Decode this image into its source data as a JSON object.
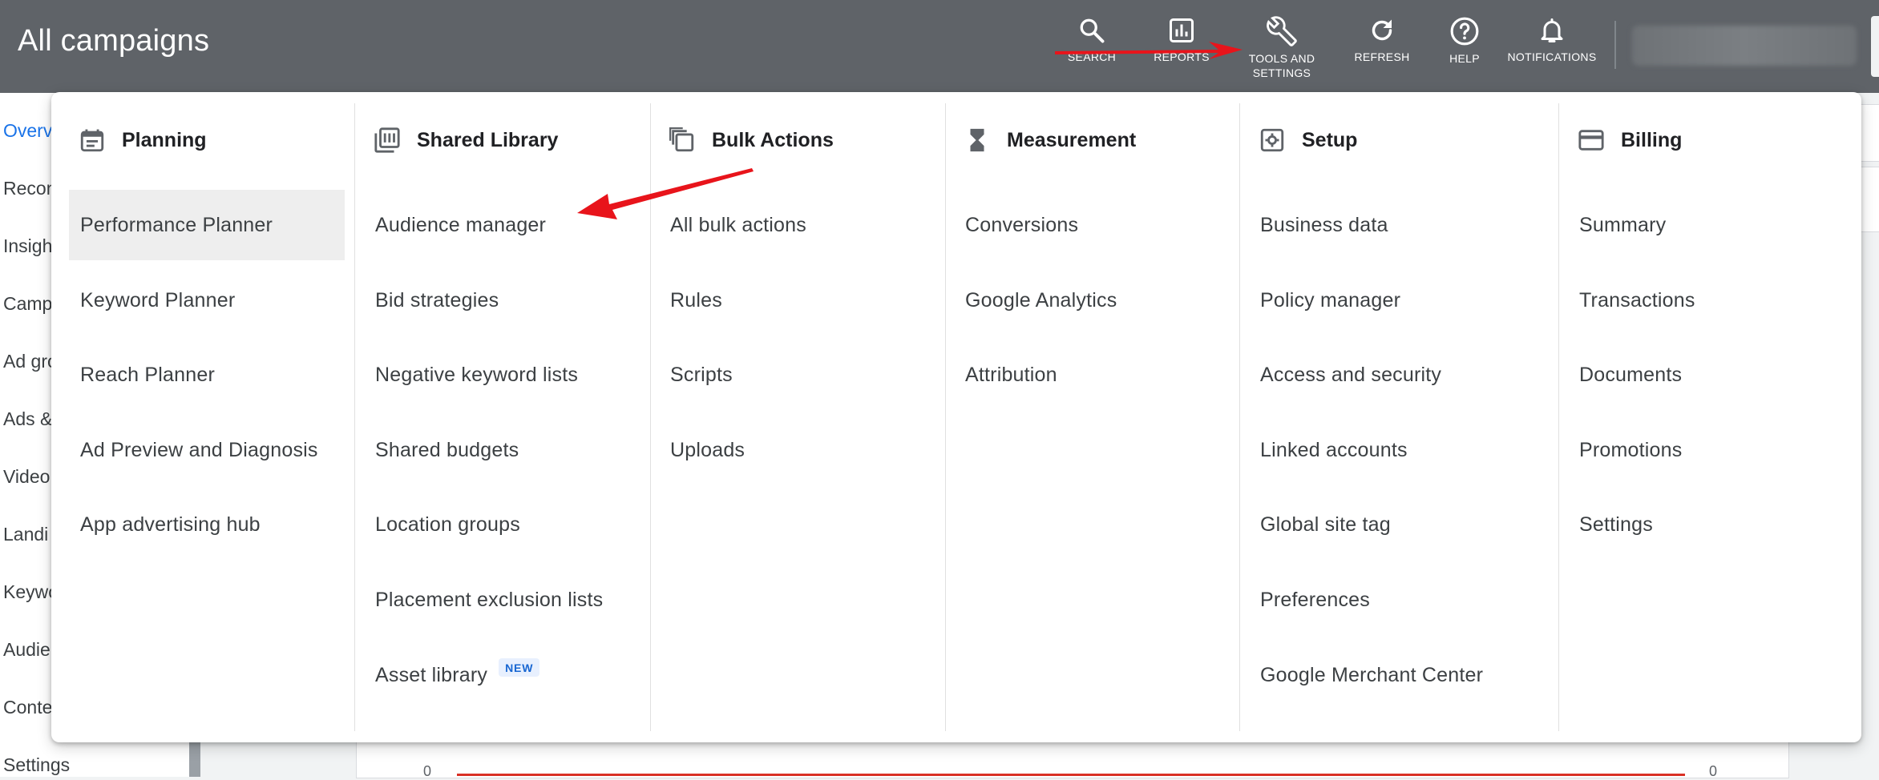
{
  "header": {
    "title": "All campaigns",
    "buttons": [
      {
        "label": "SEARCH",
        "icon": "search-icon"
      },
      {
        "label": "REPORTS",
        "icon": "reports-icon"
      },
      {
        "label": "TOOLS AND SETTINGS",
        "label_line1": "TOOLS AND",
        "label_line2": "SETTINGS",
        "icon": "wrench-icon"
      },
      {
        "label": "REFRESH",
        "icon": "refresh-icon"
      },
      {
        "label": "HELP",
        "icon": "help-icon"
      },
      {
        "label": "NOTIFICATIONS",
        "icon": "bell-icon"
      }
    ]
  },
  "left_nav": {
    "items": [
      "Overv",
      "Recon",
      "Insigh",
      "Camp",
      "Ad gro",
      "Ads &",
      "Video",
      "Landi",
      "Keywo",
      "Audie",
      "Conte",
      "Settings"
    ],
    "active_index": 0
  },
  "background": {
    "chart_zero_left": "0",
    "chart_zero_right": "0"
  },
  "menu": {
    "columns": [
      {
        "title": "Planning",
        "icon": "calendar-icon",
        "items": [
          "Performance Planner",
          "Keyword Planner",
          "Reach Planner",
          "Ad Preview and Diagnosis",
          "App advertising hub"
        ]
      },
      {
        "title": "Shared Library",
        "icon": "library-icon",
        "items": [
          "Audience manager",
          "Bid strategies",
          "Negative keyword lists",
          "Shared budgets",
          "Location groups",
          "Placement exclusion lists",
          "Asset library"
        ],
        "new_badge": "NEW"
      },
      {
        "title": "Bulk Actions",
        "icon": "copy-icon",
        "items": [
          "All bulk actions",
          "Rules",
          "Scripts",
          "Uploads"
        ]
      },
      {
        "title": "Measurement",
        "icon": "hourglass-icon",
        "items": [
          "Conversions",
          "Google Analytics",
          "Attribution"
        ]
      },
      {
        "title": "Setup",
        "icon": "settings-box-icon",
        "items": [
          "Business data",
          "Policy manager",
          "Access and security",
          "Linked accounts",
          "Global site tag",
          "Preferences",
          "Google Merchant Center"
        ]
      },
      {
        "title": "Billing",
        "icon": "credit-card-icon",
        "items": [
          "Summary",
          "Transactions",
          "Documents",
          "Promotions",
          "Settings"
        ]
      }
    ]
  },
  "colors": {
    "topbar": "#5f6368",
    "accent": "#1a73e8",
    "annotation": "#e8141b",
    "highlight": "#eeeeee"
  }
}
